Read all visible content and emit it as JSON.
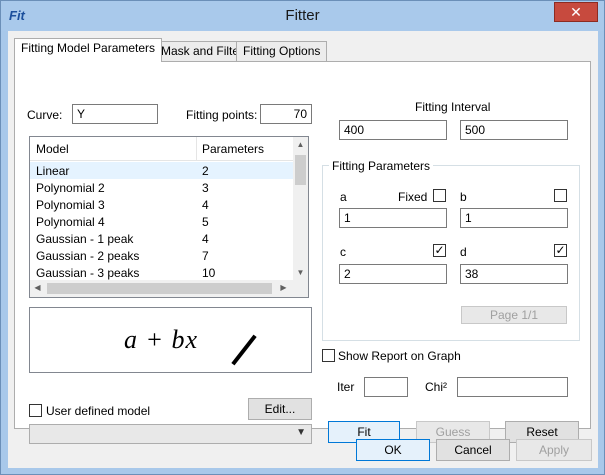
{
  "window": {
    "title": "Fitter",
    "app_icon_text": "Fit",
    "close_glyph": "✕"
  },
  "tabs": [
    {
      "label": "Fitting Model  Parameters"
    },
    {
      "label": "Mask and Filter"
    },
    {
      "label": "Fitting Options"
    }
  ],
  "curve": {
    "label": "Curve:",
    "value": "Y"
  },
  "fitting_points": {
    "label": "Fitting points:",
    "value": "70"
  },
  "help_label": "?",
  "model_list": {
    "headers": [
      "Model",
      "Parameters"
    ],
    "rows": [
      {
        "model": "Linear",
        "params": "2"
      },
      {
        "model": "Polynomial 2",
        "params": "3"
      },
      {
        "model": "Polynomial 3",
        "params": "4"
      },
      {
        "model": "Polynomial 4",
        "params": "5"
      },
      {
        "model": "Gaussian - 1 peak",
        "params": "4"
      },
      {
        "model": "Gaussian - 2 peaks",
        "params": "7"
      },
      {
        "model": "Gaussian - 3 peaks",
        "params": "10"
      }
    ]
  },
  "formula": {
    "text": "a + bx"
  },
  "user_defined": {
    "label": "User defined model"
  },
  "edit_button": "Edit...",
  "fitting_interval": {
    "label": "Fitting Interval",
    "from": "400",
    "to": "500"
  },
  "fitting_parameters": {
    "title": "Fitting Parameters",
    "fixed_label": "Fixed",
    "a": {
      "label": "a",
      "value": "1"
    },
    "b": {
      "label": "b",
      "value": "1"
    },
    "c": {
      "label": "c",
      "value": "2"
    },
    "d": {
      "label": "d",
      "value": "38"
    },
    "page_button": "Page 1/1"
  },
  "show_report": {
    "label": "Show Report on Graph"
  },
  "iter": {
    "label": "Iter",
    "value": ""
  },
  "chi": {
    "label": "Chi²",
    "value": ""
  },
  "buttons": {
    "fit": "Fit",
    "guess": "Guess",
    "reset": "Reset",
    "ok": "OK",
    "cancel": "Cancel",
    "apply": "Apply"
  },
  "check_glyph": "✓"
}
